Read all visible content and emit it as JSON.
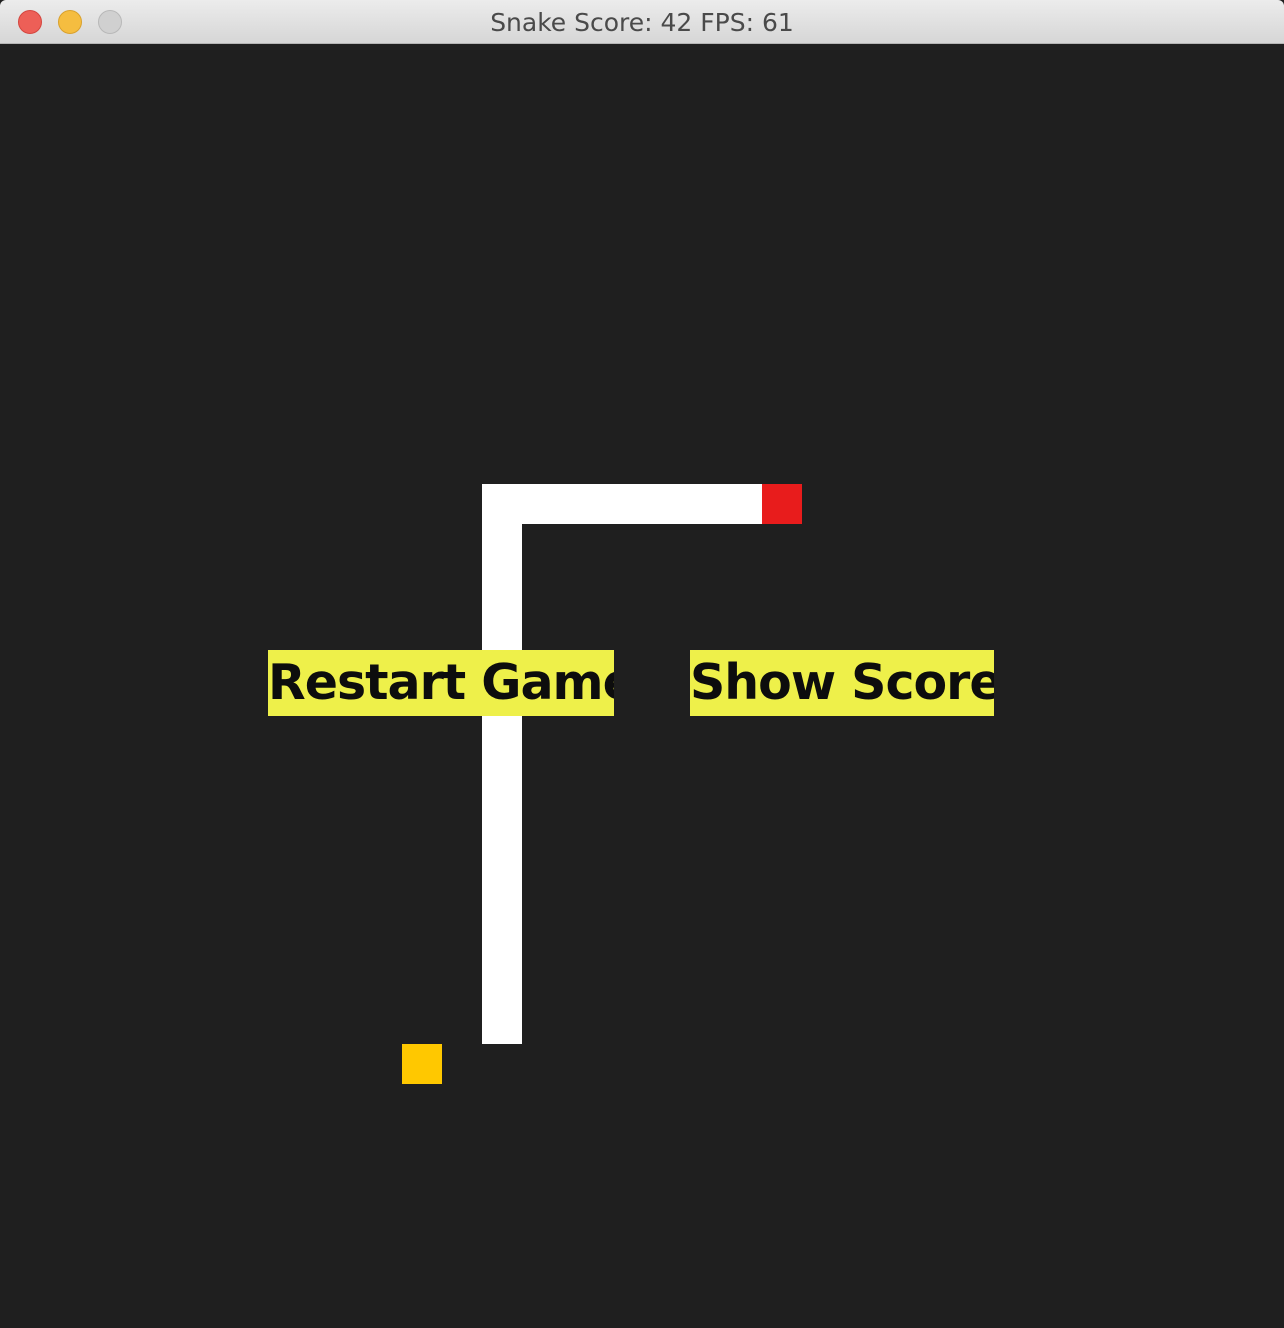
{
  "window": {
    "title": "Snake Score: 42 FPS: 61",
    "controls": [
      "close-icon",
      "minimize-icon",
      "zoom-icon"
    ]
  },
  "game": {
    "score": 42,
    "fps": 61,
    "colors": {
      "background": "#1f1f1f",
      "snake_body": "#ffffff",
      "snake_head": "#e81c1c",
      "food": "#ffc800",
      "button_bg": "#eef04a",
      "button_text": "#0d0d0d"
    }
  },
  "buttons": {
    "restart_label": "Restart Game",
    "show_score_label": "Show Score"
  }
}
